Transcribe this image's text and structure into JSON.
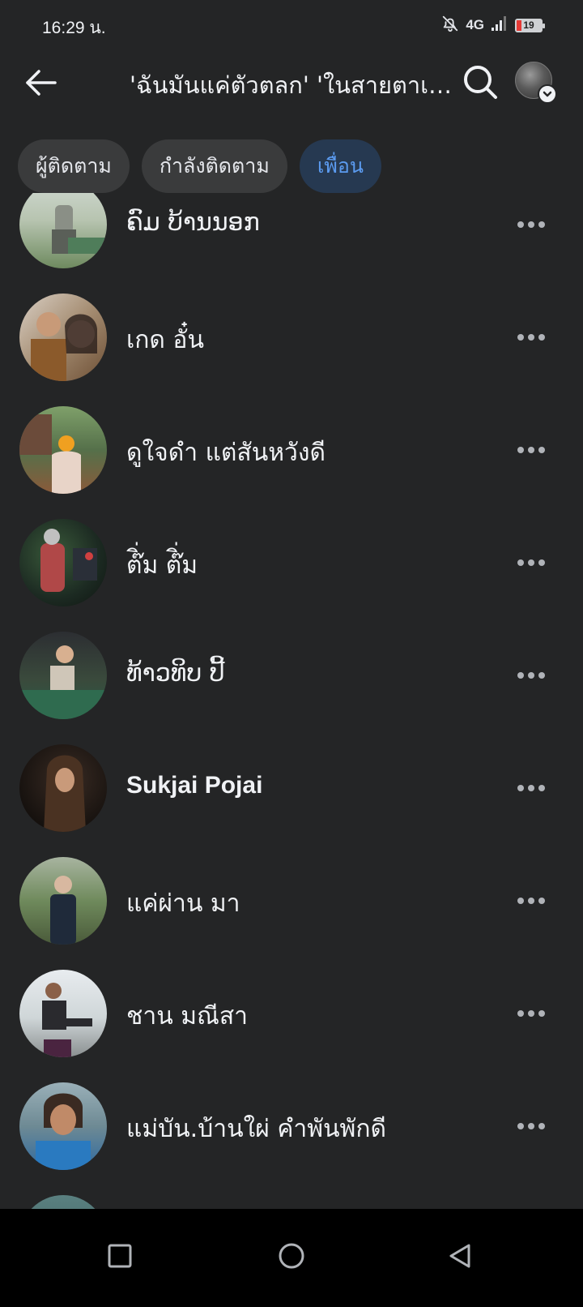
{
  "status_bar": {
    "time": "16:29 น.",
    "network": "4G",
    "battery": "19",
    "battery_fraction": 0.19,
    "icons": [
      "bell-off-icon",
      "signal-icon",
      "battery-icon"
    ]
  },
  "header": {
    "title": "'ฉันมันแค่ตัวตลก' 'ในสายตาเธอ'",
    "icons": [
      "back-arrow-icon",
      "search-icon",
      "chevron-down-icon"
    ]
  },
  "tabs": [
    {
      "label": "ผู้ติดตาม",
      "active": false
    },
    {
      "label": "กำลังติดตาม",
      "active": false
    },
    {
      "label": "เพื่อน",
      "active": true
    }
  ],
  "friends": [
    {
      "name": "ຄົມ ບ້ານນອກ",
      "latin": false
    },
    {
      "name": "เกด อั๋น",
      "latin": false
    },
    {
      "name": "ดูใจดำ แต่สันหวังดี",
      "latin": false
    },
    {
      "name": "ต๊ิ่ม ต๊ิ่ม",
      "latin": false
    },
    {
      "name": "ທ້າວທິບ ປີ້",
      "latin": false
    },
    {
      "name": "Sukjai Pojai",
      "latin": true
    },
    {
      "name": "แค่ผ่าน มา",
      "latin": false
    },
    {
      "name": "ชาน มณีสา",
      "latin": false
    },
    {
      "name": "แม่บัน.บ้านใผ่ คำพันพักดี",
      "latin": false
    },
    {
      "name": "",
      "latin": false
    }
  ],
  "nav": {
    "icons": [
      "recents-square-icon",
      "home-circle-icon",
      "back-triangle-icon"
    ]
  },
  "colors": {
    "background": "#242526",
    "tab": "#3a3b3c",
    "tab_active_bg": "#263951",
    "tab_active_text": "#5b9bf0",
    "text": "#f0f2f5",
    "icon_muted": "#b0b3b8"
  }
}
